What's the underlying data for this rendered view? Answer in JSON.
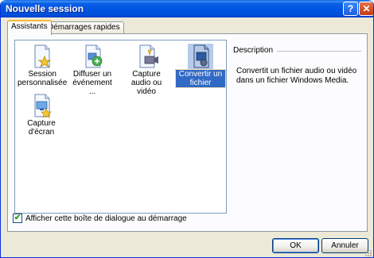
{
  "window": {
    "title": "Nouvelle session",
    "help_button": "?",
    "close_button": "✕"
  },
  "tabs": [
    {
      "label": "Assistants",
      "active": true
    },
    {
      "label": "Démarrages rapides",
      "active": false
    }
  ],
  "wizards": [
    {
      "label": "Session personnalisée",
      "icon": "custom-session-icon",
      "selected": false
    },
    {
      "label": "Diffuser un événement ...",
      "icon": "broadcast-event-icon",
      "selected": false
    },
    {
      "label": "Capture audio ou vidéo",
      "icon": "capture-audio-video-icon",
      "selected": false
    },
    {
      "label": "Convertir un fichier",
      "icon": "convert-file-icon",
      "selected": true
    },
    {
      "label": "Capture d'écran",
      "icon": "screen-capture-icon",
      "selected": false
    }
  ],
  "description": {
    "label": "Description",
    "text": "Convertit un fichier audio ou vidéo dans un fichier Windows Media."
  },
  "show_at_startup": {
    "label": "Afficher cette boîte de dialogue au démarrage",
    "checked": true
  },
  "buttons": {
    "ok": "OK",
    "cancel": "Annuler"
  },
  "colors": {
    "titlebar": "#0054e3",
    "selection": "#316ac5",
    "dialog_bg": "#ece9d8"
  }
}
